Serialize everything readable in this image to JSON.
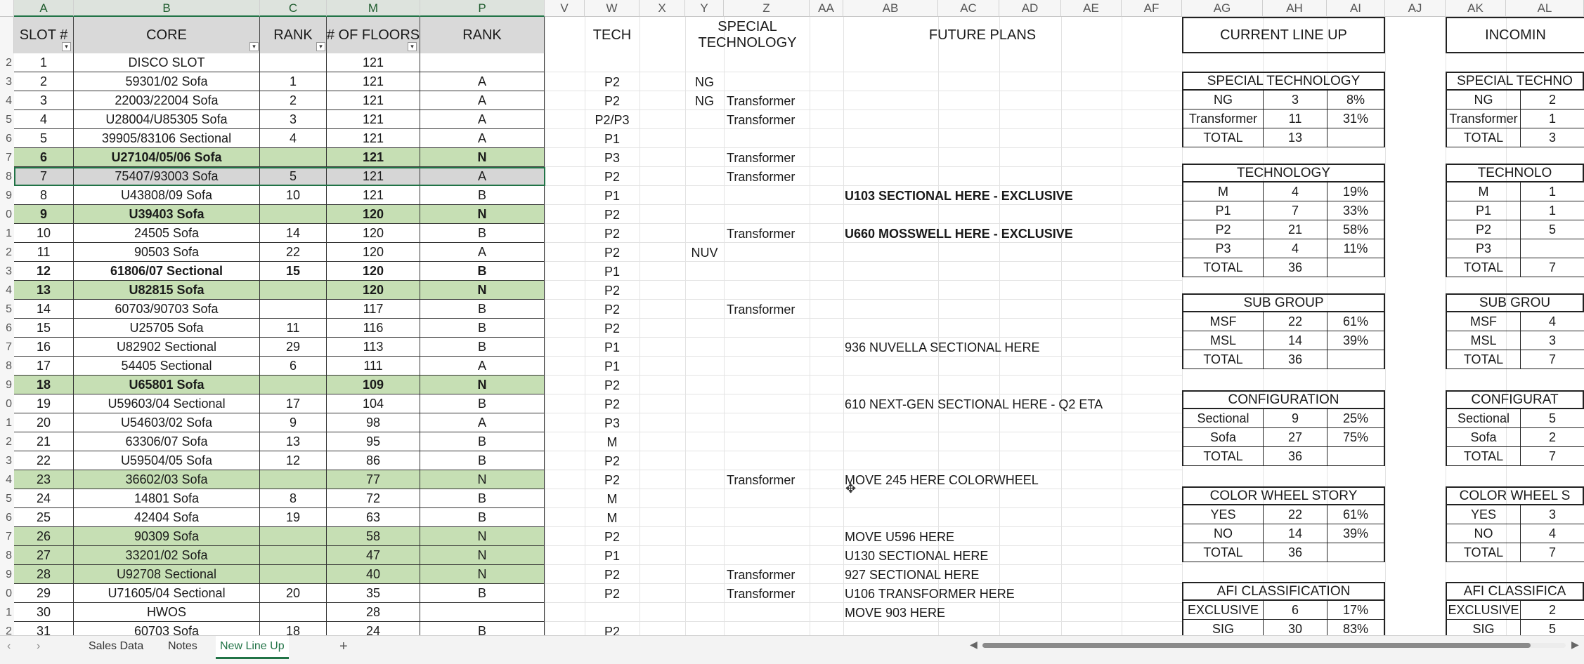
{
  "columns_letters": [
    "A",
    "B",
    "C",
    "M",
    "P",
    "V",
    "W",
    "X",
    "Y",
    "Z",
    "AA",
    "AB",
    "AC",
    "AD",
    "AE",
    "AF",
    "AG",
    "AH",
    "AI",
    "AJ",
    "AK",
    "AL"
  ],
  "headers": {
    "slot": "SLOT #",
    "core": "CORE",
    "rank1": "RANK",
    "floors": "# OF FLOORS",
    "rank2": "RANK",
    "tech": "TECH",
    "special": "SPECIAL TECHNOLOGY",
    "future": "FUTURE PLANS",
    "current": "CURRENT LINE UP",
    "incoming": "INCOMIN"
  },
  "row_numbers": [
    "2",
    "3",
    "4",
    "5",
    "6",
    "7",
    "8",
    "9",
    "0",
    "1",
    "3",
    "4",
    "5",
    "6",
    "7",
    "9",
    "0",
    "1",
    "2",
    "3",
    "4",
    "5",
    "6",
    "7",
    "8",
    "9",
    "0",
    "1",
    "2"
  ],
  "rows": [
    {
      "slot": "1",
      "core": "DISCO SLOT",
      "rank": "",
      "floors": "121",
      "rank2": "",
      "tech": "",
      "tech2": "",
      "special": "",
      "future": "",
      "style": ""
    },
    {
      "slot": "2",
      "core": "59301/02 Sofa",
      "rank": "1",
      "floors": "121",
      "rank2": "A",
      "tech": "P2",
      "tech2": "NG",
      "special": "",
      "future": "",
      "style": ""
    },
    {
      "slot": "3",
      "core": "22003/22004 Sofa",
      "rank": "2",
      "floors": "121",
      "rank2": "A",
      "tech": "P2",
      "tech2": "NG",
      "special": "Transformer",
      "future": "",
      "style": ""
    },
    {
      "slot": "4",
      "core": "U28004/U85305 Sofa",
      "rank": "3",
      "floors": "121",
      "rank2": "A",
      "tech": "P2/P3",
      "tech2": "",
      "special": "Transformer",
      "future": "",
      "style": ""
    },
    {
      "slot": "5",
      "core": "39905/83106 Sectional",
      "rank": "4",
      "floors": "121",
      "rank2": "A",
      "tech": "P1",
      "tech2": "",
      "special": "",
      "future": "",
      "style": ""
    },
    {
      "slot": "6",
      "core": "U27104/05/06 Sofa",
      "rank": "",
      "floors": "121",
      "rank2": "N",
      "tech": "P3",
      "tech2": "",
      "special": "Transformer",
      "future": "",
      "style": "green"
    },
    {
      "slot": "7",
      "core": "75407/93003 Sofa",
      "rank": "5",
      "floors": "121",
      "rank2": "A",
      "tech": "P2",
      "tech2": "",
      "special": "Transformer",
      "future": "",
      "style": "grey"
    },
    {
      "slot": "8",
      "core": "U43808/09 Sofa",
      "rank": "10",
      "floors": "121",
      "rank2": "B",
      "tech": "P1",
      "tech2": "",
      "special": "",
      "future": "U103 SECTIONAL HERE - EXCLUSIVE",
      "style": "futurebold"
    },
    {
      "slot": "9",
      "core": "U39403 Sofa",
      "rank": "",
      "floors": "120",
      "rank2": "N",
      "tech": "P2",
      "tech2": "",
      "special": "",
      "future": "",
      "style": "green"
    },
    {
      "slot": "10",
      "core": "24505 Sofa",
      "rank": "14",
      "floors": "120",
      "rank2": "B",
      "tech": "P2",
      "tech2": "",
      "special": "Transformer",
      "future": "U660 MOSSWELL HERE - EXCLUSIVE",
      "style": "futurebold"
    },
    {
      "slot": "11",
      "core": "90503 Sofa",
      "rank": "22",
      "floors": "120",
      "rank2": "A",
      "tech": "P2",
      "tech2": "NUV",
      "special": "",
      "future": "",
      "style": ""
    },
    {
      "slot": "12",
      "core": "61806/07 Sectional",
      "rank": "15",
      "floors": "120",
      "rank2": "B",
      "tech": "P1",
      "tech2": "",
      "special": "",
      "future": "",
      "style": "bold"
    },
    {
      "slot": "13",
      "core": "U82815 Sofa",
      "rank": "",
      "floors": "120",
      "rank2": "N",
      "tech": "P2",
      "tech2": "",
      "special": "",
      "future": "",
      "style": "green"
    },
    {
      "slot": "14",
      "core": "60703/90703 Sofa",
      "rank": "",
      "floors": "117",
      "rank2": "B",
      "tech": "P2",
      "tech2": "",
      "special": "Transformer",
      "future": "",
      "style": ""
    },
    {
      "slot": "15",
      "core": "U25705 Sofa",
      "rank": "11",
      "floors": "116",
      "rank2": "B",
      "tech": "P2",
      "tech2": "",
      "special": "",
      "future": "",
      "style": ""
    },
    {
      "slot": "16",
      "core": "U82902 Sectional",
      "rank": "29",
      "floors": "113",
      "rank2": "B",
      "tech": "P1",
      "tech2": "",
      "special": "",
      "future": "936 NUVELLA SECTIONAL HERE",
      "style": ""
    },
    {
      "slot": "17",
      "core": "54405 Sectional",
      "rank": "6",
      "floors": "111",
      "rank2": "A",
      "tech": "P1",
      "tech2": "",
      "special": "",
      "future": "",
      "style": ""
    },
    {
      "slot": "18",
      "core": "U65801 Sofa",
      "rank": "",
      "floors": "109",
      "rank2": "N",
      "tech": "P2",
      "tech2": "",
      "special": "",
      "future": "",
      "style": "green"
    },
    {
      "slot": "19",
      "core": "U59603/04 Sectional",
      "rank": "17",
      "floors": "104",
      "rank2": "B",
      "tech": "P2",
      "tech2": "",
      "special": "",
      "future": "610 NEXT-GEN SECTIONAL HERE - Q2 ETA",
      "style": ""
    },
    {
      "slot": "20",
      "core": "U54603/02 Sofa",
      "rank": "9",
      "floors": "98",
      "rank2": "A",
      "tech": "P3",
      "tech2": "",
      "special": "",
      "future": "",
      "style": ""
    },
    {
      "slot": "21",
      "core": "63306/07 Sofa",
      "rank": "13",
      "floors": "95",
      "rank2": "B",
      "tech": "M",
      "tech2": "",
      "special": "",
      "future": "",
      "style": ""
    },
    {
      "slot": "22",
      "core": "U59504/05 Sofa",
      "rank": "12",
      "floors": "86",
      "rank2": "B",
      "tech": "P2",
      "tech2": "",
      "special": "",
      "future": "",
      "style": ""
    },
    {
      "slot": "23",
      "core": "36602/03 Sofa",
      "rank": "",
      "floors": "77",
      "rank2": "N",
      "tech": "P2",
      "tech2": "",
      "special": "Transformer",
      "future": "MOVE 245 HERE COLORWHEEL",
      "style": "green2"
    },
    {
      "slot": "24",
      "core": "14801 Sofa",
      "rank": "8",
      "floors": "72",
      "rank2": "B",
      "tech": "M",
      "tech2": "",
      "special": "",
      "future": "",
      "style": ""
    },
    {
      "slot": "25",
      "core": "42404 Sofa",
      "rank": "19",
      "floors": "63",
      "rank2": "B",
      "tech": "M",
      "tech2": "",
      "special": "",
      "future": "",
      "style": ""
    },
    {
      "slot": "26",
      "core": "90309 Sofa",
      "rank": "",
      "floors": "58",
      "rank2": "N",
      "tech": "P2",
      "tech2": "",
      "special": "",
      "future": "MOVE U596 HERE",
      "style": "green2"
    },
    {
      "slot": "27",
      "core": "33201/02 Sofa",
      "rank": "",
      "floors": "47",
      "rank2": "N",
      "tech": "P1",
      "tech2": "",
      "special": "",
      "future": "U130 SECTIONAL HERE",
      "style": "green2"
    },
    {
      "slot": "28",
      "core": "U92708 Sectional",
      "rank": "",
      "floors": "40",
      "rank2": "N",
      "tech": "P2",
      "tech2": "",
      "special": "Transformer",
      "future": "927 SECTIONAL HERE",
      "style": "green2"
    },
    {
      "slot": "29",
      "core": "U71605/04 Sectional",
      "rank": "20",
      "floors": "35",
      "rank2": "B",
      "tech": "P2",
      "tech2": "",
      "special": "Transformer",
      "future": "U106 TRANSFORMER HERE",
      "style": ""
    },
    {
      "slot": "30",
      "core": "HWOS",
      "rank": "",
      "floors": "28",
      "rank2": "",
      "tech": "",
      "tech2": "",
      "special": "",
      "future": "MOVE 903 HERE",
      "style": ""
    },
    {
      "slot": "31",
      "core": "60703 Sofa",
      "rank": "18",
      "floors": "24",
      "rank2": "B",
      "tech": "P2",
      "tech2": "",
      "special": "",
      "future": "",
      "style": ""
    }
  ],
  "summary_current": [
    {
      "title": "SPECIAL TECHNOLOGY",
      "rows": [
        [
          "NG",
          "3",
          "8%"
        ],
        [
          "Transformer",
          "11",
          "31%"
        ],
        [
          "TOTAL",
          "13",
          ""
        ]
      ]
    },
    {
      "title": "TECHNOLOGY",
      "rows": [
        [
          "M",
          "4",
          "19%"
        ],
        [
          "P1",
          "7",
          "33%"
        ],
        [
          "P2",
          "21",
          "58%"
        ],
        [
          "P3",
          "4",
          "11%"
        ],
        [
          "TOTAL",
          "36",
          ""
        ]
      ]
    },
    {
      "title": "SUB GROUP",
      "rows": [
        [
          "MSF",
          "22",
          "61%"
        ],
        [
          "MSL",
          "14",
          "39%"
        ],
        [
          "TOTAL",
          "36",
          ""
        ]
      ]
    },
    {
      "title": "CONFIGURATION",
      "rows": [
        [
          "Sectional",
          "9",
          "25%"
        ],
        [
          "Sofa",
          "27",
          "75%"
        ],
        [
          "TOTAL",
          "36",
          ""
        ]
      ]
    },
    {
      "title": "COLOR WHEEL STORY",
      "rows": [
        [
          "YES",
          "22",
          "61%"
        ],
        [
          "NO",
          "14",
          "39%"
        ],
        [
          "TOTAL",
          "36",
          ""
        ]
      ]
    },
    {
      "title": "AFI CLASSIFICATION",
      "rows": [
        [
          "EXCLUSIVE",
          "6",
          "17%"
        ],
        [
          "SIG",
          "30",
          "83%"
        ]
      ]
    }
  ],
  "summary_incoming": [
    {
      "title": "SPECIAL TECHNO",
      "rows": [
        [
          "NG",
          "2"
        ],
        [
          "Transformer",
          "1"
        ],
        [
          "TOTAL",
          "3"
        ]
      ]
    },
    {
      "title": "TECHNOLO",
      "rows": [
        [
          "M",
          "1"
        ],
        [
          "P1",
          "1"
        ],
        [
          "P2",
          "5"
        ],
        [
          "P3",
          ""
        ],
        [
          "TOTAL",
          "7"
        ]
      ]
    },
    {
      "title": "SUB GROU",
      "rows": [
        [
          "MSF",
          "4"
        ],
        [
          "MSL",
          "3"
        ],
        [
          "TOTAL",
          "7"
        ]
      ]
    },
    {
      "title": "CONFIGURAT",
      "rows": [
        [
          "Sectional",
          "5"
        ],
        [
          "Sofa",
          "2"
        ],
        [
          "TOTAL",
          "7"
        ]
      ]
    },
    {
      "title": "COLOR WHEEL S",
      "rows": [
        [
          "YES",
          "3"
        ],
        [
          "NO",
          "4"
        ],
        [
          "TOTAL",
          "7"
        ]
      ]
    },
    {
      "title": "AFI CLASSIFICA",
      "rows": [
        [
          "EXCLUSIVE",
          "2"
        ],
        [
          "SIG",
          "5"
        ]
      ]
    }
  ],
  "tabs": [
    "Sales Data",
    "Notes",
    "New Line Up"
  ],
  "active_tab": "New Line Up",
  "add_sheet": "+",
  "colors": {
    "green": "#c6dfb4",
    "grey": "#d6d6d6",
    "header": "#d9d9d9",
    "accent": "#217346"
  }
}
